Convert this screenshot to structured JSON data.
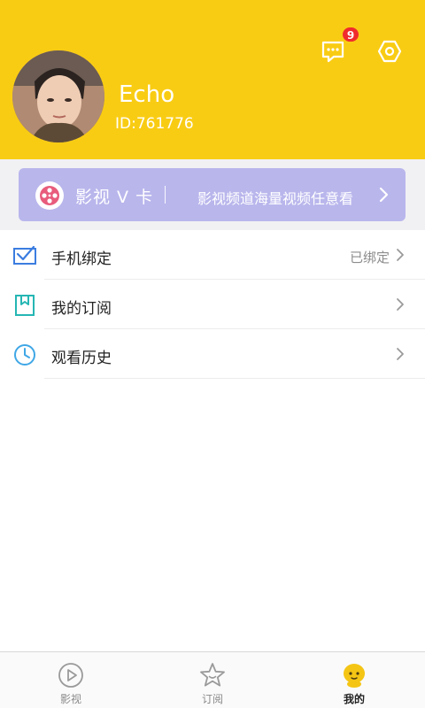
{
  "header": {
    "username": "Echo",
    "user_id": "ID:761776",
    "message_badge": "9",
    "message_icon": "message-icon",
    "settings_icon": "settings-icon"
  },
  "vcard": {
    "logo_icon": "film-reel-icon",
    "title": "影视 V 卡",
    "description": "影视频道海量视频任意看"
  },
  "menu": {
    "items": [
      {
        "icon": "envelope-check-icon",
        "label": "手机绑定",
        "value": "已绑定"
      },
      {
        "icon": "bookmark-icon",
        "label": "我的订阅",
        "value": ""
      },
      {
        "icon": "clock-icon",
        "label": "观看历史",
        "value": ""
      }
    ]
  },
  "tabbar": {
    "tabs": [
      {
        "icon": "play-circle-icon",
        "label": "影视",
        "active": false
      },
      {
        "icon": "star-icon",
        "label": "订阅",
        "active": false
      },
      {
        "icon": "mascot-icon",
        "label": "我的",
        "active": true
      }
    ]
  },
  "colors": {
    "header_bg": "#f9cc14",
    "vcard_bg": "#b9b6ec",
    "badge_bg": "#f02c2c",
    "accent_blue": "#3b7de0",
    "accent_teal": "#25b6b3"
  }
}
